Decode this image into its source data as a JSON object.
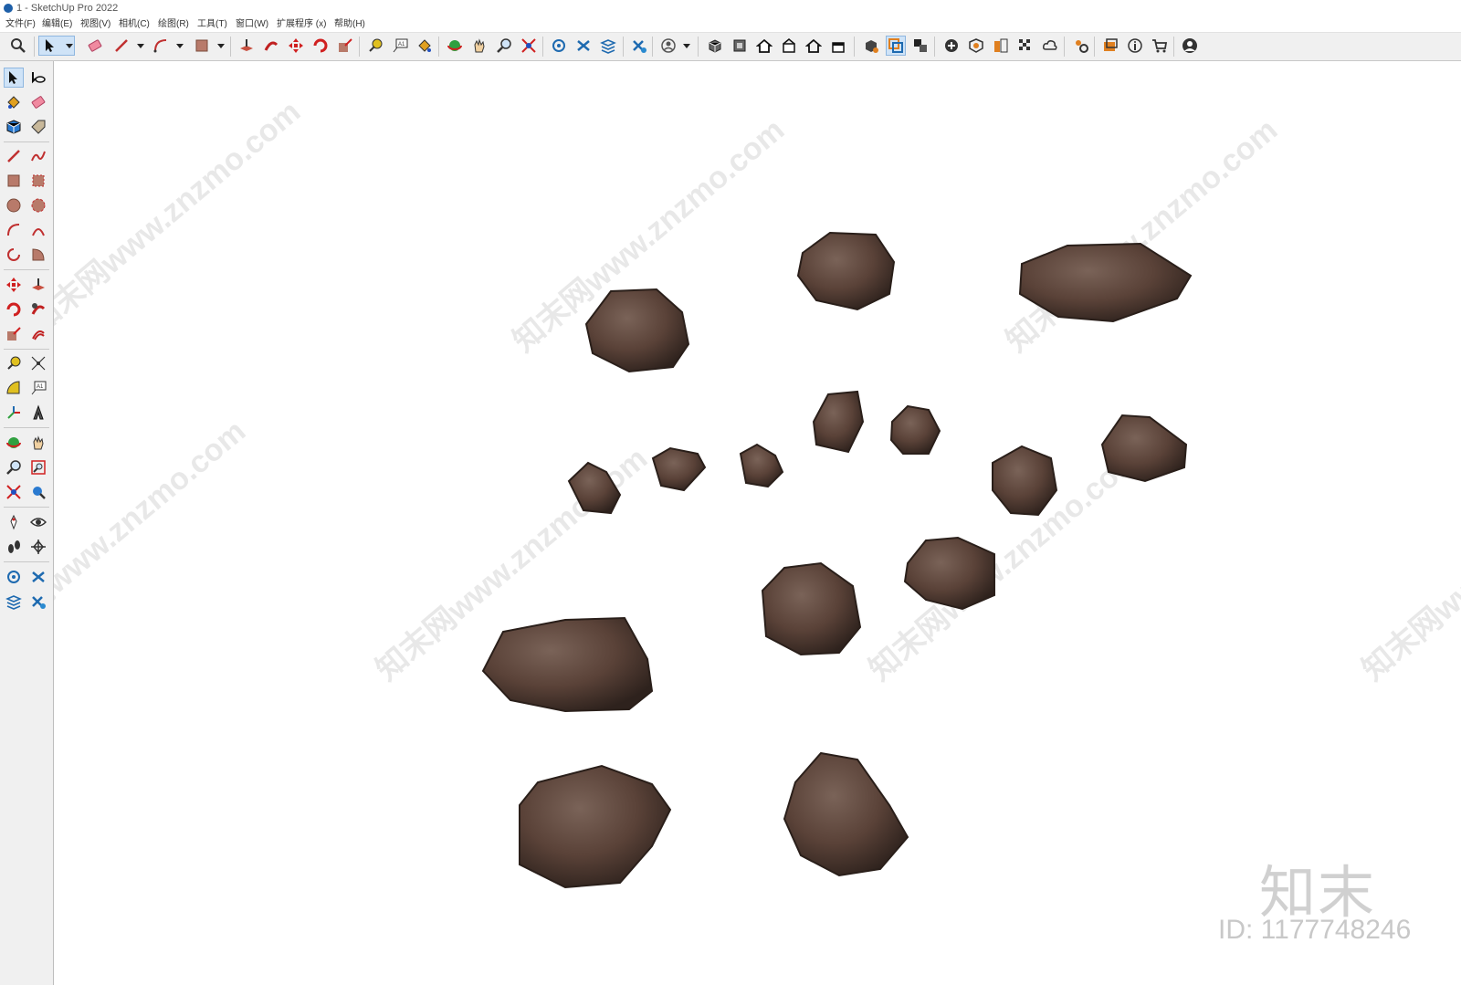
{
  "window": {
    "title": "1 - SketchUp Pro 2022"
  },
  "menu": {
    "items": [
      "文件(F)",
      "编辑(E)",
      "视图(V)",
      "相机(C)",
      "绘图(R)",
      "工具(T)",
      "窗口(W)",
      "扩展程序 (x)",
      "帮助(H)"
    ]
  },
  "toolbar": {
    "icons": [
      "search-icon",
      "select-icon",
      "eraser-icon",
      "pencil-icon",
      "arc-icon",
      "rectangle-icon",
      "push-pull-icon",
      "follow-me-icon",
      "move-icon",
      "rotate-icon",
      "scale-icon",
      "tape-measure-icon",
      "text-icon",
      "paint-bucket-icon",
      "orbit-icon",
      "pan-icon",
      "zoom-icon",
      "zoom-extents-icon",
      "layers-icon",
      "components-icon",
      "3d-warehouse-icon",
      "sandbox-icon",
      "account-icon",
      "iso-view-icon",
      "top-view-icon",
      "front-view-icon",
      "right-view-icon",
      "back-view-icon",
      "left-view-icon",
      "section-plane-icon",
      "display-section-icon",
      "scene-icon",
      "add-icon",
      "styles-icon",
      "materials-icon",
      "shadows-icon",
      "cloud-icon",
      "extensions-icon",
      "presentation-icon",
      "info-icon",
      "cart-icon",
      "profile-icon"
    ]
  },
  "left_toolbar": {
    "icons": [
      "select-icon",
      "orbit-icon",
      "paint-bucket-icon",
      "eraser-icon",
      "component-icon",
      "tag-icon",
      "line-icon",
      "freehand-icon",
      "rectangle-icon",
      "rotated-rectangle-icon",
      "circle-icon",
      "polygon-icon",
      "arc-icon",
      "two-point-arc-icon",
      "pie-icon",
      "three-point-arc-icon",
      "move-icon",
      "push-pull-icon",
      "rotate-icon",
      "follow-me-icon",
      "scale-icon",
      "offset-icon",
      "tape-measure-icon",
      "dimension-icon",
      "protractor-icon",
      "text-icon",
      "axes-icon",
      "3d-text-icon",
      "orbit-tool-icon",
      "pan-icon",
      "zoom-icon",
      "zoom-window-icon",
      "zoom-extents-icon",
      "previous-view-icon",
      "position-camera-icon",
      "look-around-icon",
      "walk-icon",
      "section-plane-icon",
      "sandbox-from-contours-icon",
      "sandbox-smoove-icon",
      "sandbox-stamp-icon",
      "sandbox-drape-icon"
    ]
  },
  "colors": {
    "rock_dark": "#3a2c25",
    "rock_mid": "#5a4238",
    "rock_light": "#7a6358",
    "toolbar_bg": "#f0f0f0",
    "accent": "#1e5fa8"
  },
  "watermark": {
    "text": "知末网www.znzmo.com"
  },
  "brand": {
    "logo": "知末",
    "id": "ID: 1177748246"
  }
}
